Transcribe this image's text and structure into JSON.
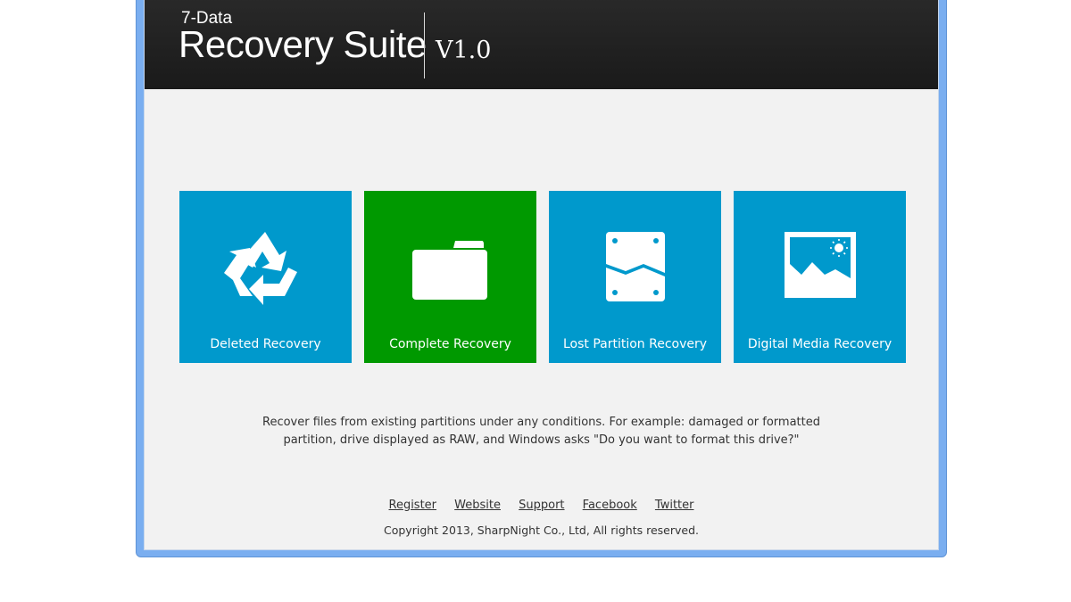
{
  "header": {
    "brand_small": "7-Data",
    "brand_big": "Recovery Suite",
    "version": "V1.0",
    "background_color": "#1f1f1f"
  },
  "tiles": [
    {
      "label": "Deleted Recovery",
      "icon": "recycle-icon",
      "color": "#0099cc"
    },
    {
      "label": "Complete Recovery",
      "icon": "folder-icon",
      "color": "#009900"
    },
    {
      "label": "Lost Partition Recovery",
      "icon": "partition-icon",
      "color": "#0099cc"
    },
    {
      "label": "Digital Media Recovery",
      "icon": "picture-icon",
      "color": "#0099cc"
    }
  ],
  "description": {
    "line1": "Recover files from existing partitions under any conditions. For example: damaged or formatted",
    "line2": "partition, drive displayed as RAW, and Windows asks \"Do you want to format this drive?\""
  },
  "footer": {
    "links": [
      "Register",
      "Website",
      "Support",
      "Facebook",
      "Twitter"
    ],
    "copyright": "Copyright 2013, SharpNight Co., Ltd, All rights reserved."
  },
  "window": {
    "frame_color": "#7aaef0",
    "client_background": "#f2f2f2"
  }
}
